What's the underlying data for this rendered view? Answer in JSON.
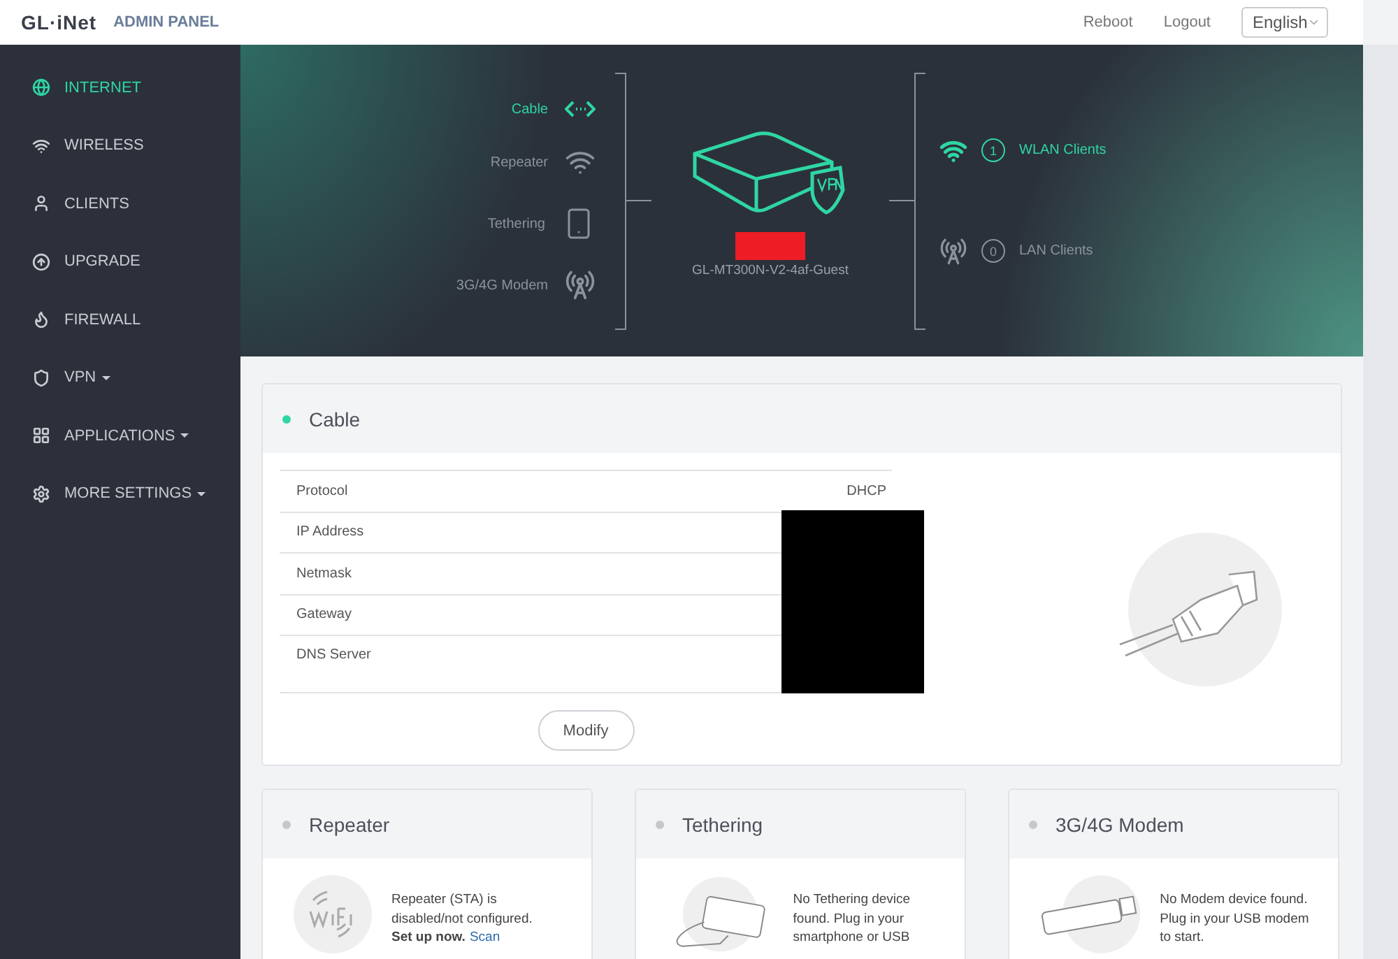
{
  "header": {
    "logo": "GL·iNet",
    "subtitle": "ADMIN PANEL",
    "links": [
      "Reboot",
      "Logout"
    ],
    "language": "English"
  },
  "sidebar": {
    "items": [
      {
        "label": "INTERNET",
        "kind": "globe",
        "selected": true,
        "dropdown": false
      },
      {
        "label": "WIRELESS",
        "kind": "wifi",
        "selected": false,
        "dropdown": false
      },
      {
        "label": "CLIENTS",
        "kind": "user",
        "selected": false,
        "dropdown": false
      },
      {
        "label": "UPGRADE",
        "kind": "upgrade",
        "selected": false,
        "dropdown": false
      },
      {
        "label": "FIREWALL",
        "kind": "flame",
        "selected": false,
        "dropdown": false
      },
      {
        "label": "VPN",
        "kind": "shield",
        "selected": false,
        "dropdown": true
      },
      {
        "label": "APPLICATIONS",
        "kind": "grid",
        "selected": false,
        "dropdown": true
      },
      {
        "label": "MORE SETTINGS",
        "kind": "gear",
        "selected": false,
        "dropdown": true
      }
    ]
  },
  "banner": {
    "sources": [
      {
        "label": "Cable",
        "kind": "cable",
        "selected": true
      },
      {
        "label": "Repeater",
        "kind": "wifi",
        "selected": false
      },
      {
        "label": "Tethering",
        "kind": "phone",
        "selected": false
      },
      {
        "label": "3G/4G Modem",
        "kind": "tower",
        "selected": false
      }
    ],
    "device": {
      "name": "GL-MT300N-V2-4af-Guest"
    },
    "clients": [
      {
        "count": "1",
        "label": "WLAN Clients",
        "kind": "wlan",
        "active": true
      },
      {
        "count": "0",
        "label": "LAN Clients",
        "kind": "lan",
        "active": false
      }
    ]
  },
  "cable_panel": {
    "title": "Cable",
    "active": true,
    "rows": [
      {
        "label": "Protocol",
        "value": "DHCP"
      },
      {
        "label": "IP Address"
      },
      {
        "label": "Netmask"
      },
      {
        "label": "Gateway"
      },
      {
        "label": "DNS Server"
      }
    ],
    "button": "Modify"
  },
  "cards": [
    {
      "title": "Repeater",
      "kind": "wifi",
      "active": false,
      "text": "Repeater (STA) is disabled/not configured.",
      "action": "Set up now.",
      "link": "Scan"
    },
    {
      "title": "Tethering",
      "kind": "phone",
      "active": false,
      "text": "No Tethering device found. Plug in your smartphone or USB"
    },
    {
      "title": "3G/4G Modem",
      "kind": "modem",
      "active": false,
      "text": "No Modem device found. Plug in your USB modem to start."
    }
  ]
}
